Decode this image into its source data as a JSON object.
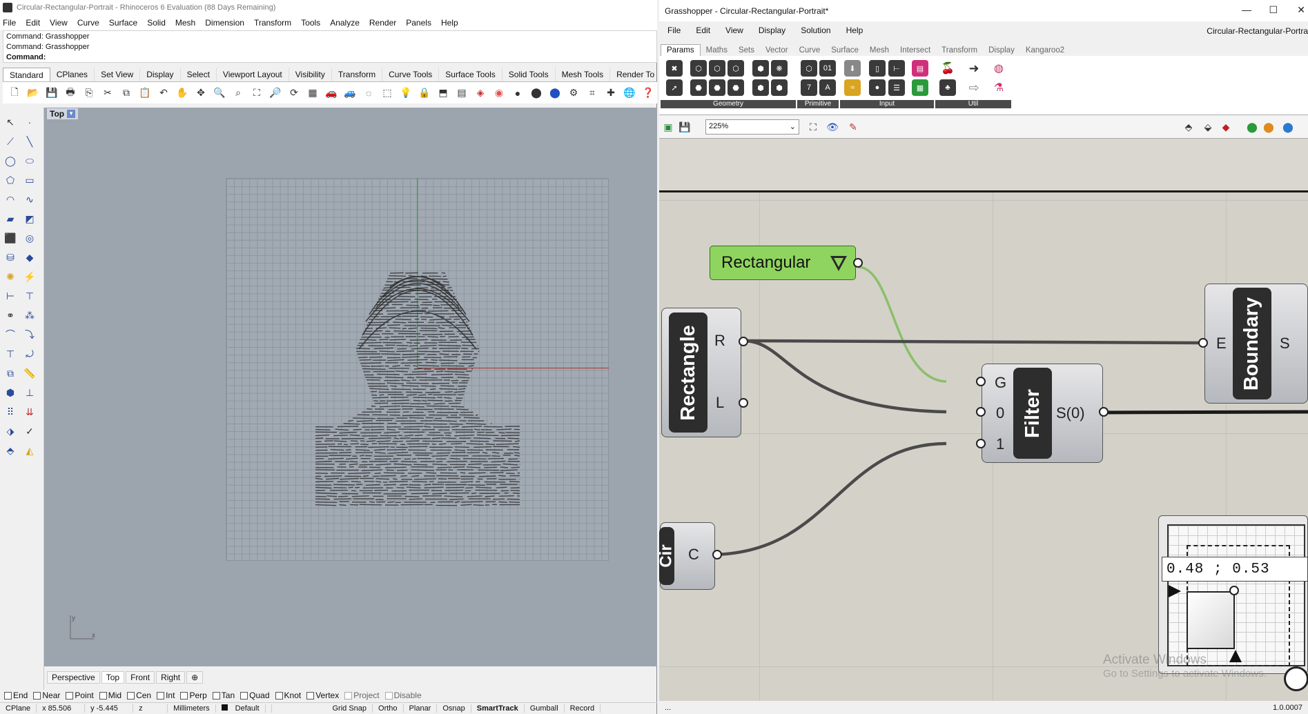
{
  "rhino": {
    "title": "Circular-Rectangular-Portrait - Rhinoceros 6 Evaluation (88 Days Remaining)",
    "menu": [
      "File",
      "Edit",
      "View",
      "Curve",
      "Surface",
      "Solid",
      "Mesh",
      "Dimension",
      "Transform",
      "Tools",
      "Analyze",
      "Render",
      "Panels",
      "Help"
    ],
    "command_history": [
      "Command: Grasshopper",
      "Command: Grasshopper"
    ],
    "command_prompt": "Command:",
    "toolbar_tabs": [
      "Standard",
      "CPlanes",
      "Set View",
      "Display",
      "Select",
      "Viewport Layout",
      "Visibility",
      "Transform",
      "Curve Tools",
      "Surface Tools",
      "Solid Tools",
      "Mesh Tools",
      "Render To"
    ],
    "viewport_label": "Top",
    "axis_labels": {
      "x": "x",
      "y": "y"
    },
    "viewport_tabs": [
      "Perspective",
      "Top",
      "Front",
      "Right"
    ],
    "osnaps": [
      {
        "label": "End"
      },
      {
        "label": "Near"
      },
      {
        "label": "Point"
      },
      {
        "label": "Mid"
      },
      {
        "label": "Cen"
      },
      {
        "label": "Int"
      },
      {
        "label": "Perp"
      },
      {
        "label": "Tan"
      },
      {
        "label": "Quad"
      },
      {
        "label": "Knot"
      },
      {
        "label": "Vertex"
      },
      {
        "label": "Project"
      },
      {
        "label": "Disable"
      }
    ],
    "status": {
      "cplane": "CPlane",
      "x": "x 85.506",
      "y": "y -5.445",
      "z": "z",
      "units": "Millimeters",
      "layer": "Default",
      "grid_snap": "Grid Snap",
      "ortho": "Ortho",
      "planar": "Planar",
      "osnap": "Osnap",
      "smarttrack": "SmartTrack",
      "gumball": "Gumball",
      "record": "Record"
    }
  },
  "gh": {
    "title": "Grasshopper - Circular-Rectangular-Portrait*",
    "doc_name": "Circular-Rectangular-Portra",
    "menu": [
      "File",
      "Edit",
      "View",
      "Display",
      "Solution",
      "Help"
    ],
    "tabs": [
      "Params",
      "Maths",
      "Sets",
      "Vector",
      "Curve",
      "Surface",
      "Mesh",
      "Intersect",
      "Transform",
      "Display",
      "Kangaroo2"
    ],
    "ribbon_groups": [
      "Geometry",
      "Primitive",
      "Input",
      "Util"
    ],
    "zoom": "225%",
    "components": {
      "value_list": "Rectangular",
      "rectangle": {
        "name": "Rectangle",
        "outputs": [
          "R",
          "L"
        ]
      },
      "filter": {
        "name": "Filter",
        "inputs": [
          "G",
          "0",
          "1"
        ],
        "output": "S(0)"
      },
      "boundary": {
        "name": "Boundary",
        "input": "E",
        "output": "S"
      },
      "circle": {
        "name": "Cir",
        "output": "C"
      }
    },
    "md_slider": "0.48 ; 0.53",
    "watermark": [
      "Activate Windows",
      "Go to Settings to activate Windows."
    ],
    "status": {
      "left": "...",
      "right": "1.0.0007"
    },
    "colors": {
      "canvas": "#d4d1c8",
      "value_list": "#8fd45f",
      "active_wire": "#8bc06a",
      "wire": "#4a4a4a"
    }
  }
}
